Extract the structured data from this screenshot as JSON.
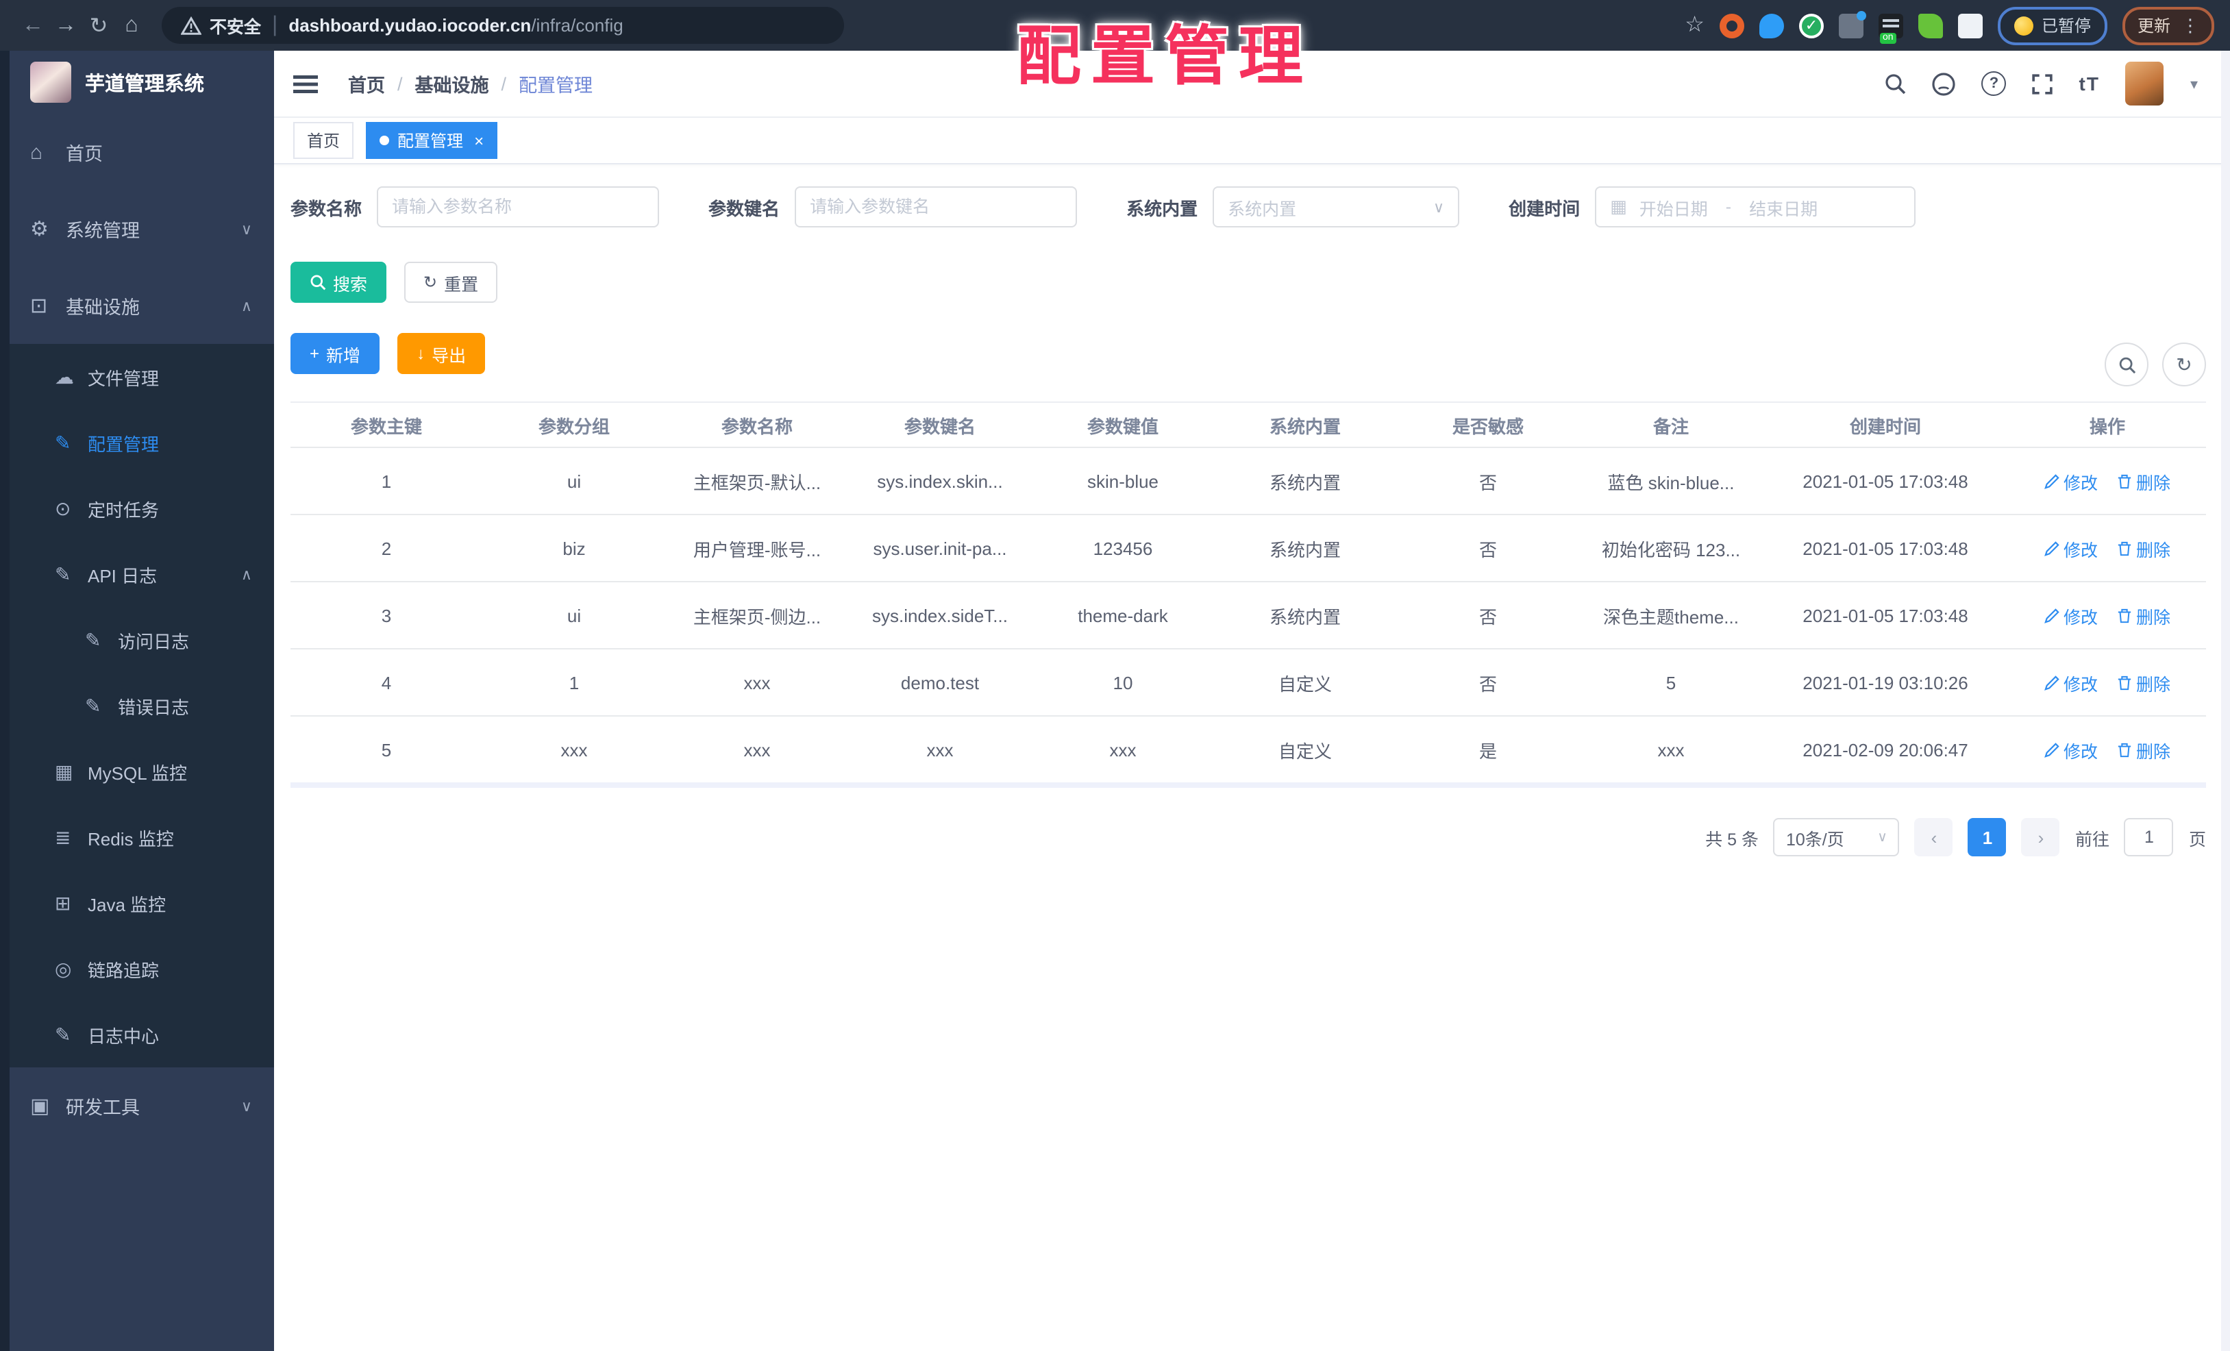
{
  "browser": {
    "security": "不安全",
    "host": "dashboard.yudao.iocoder.cn",
    "path": "/infra/config",
    "paused": "已暂停",
    "update": "更新"
  },
  "watermark": "配置管理",
  "sidebar": {
    "title": "芋道管理系统",
    "home": "首页",
    "system": "系统管理",
    "infra": "基础设施",
    "sub": [
      "文件管理",
      "配置管理",
      "定时任务",
      "API 日志",
      "访问日志",
      "错误日志",
      "MySQL 监控",
      "Redis 监控",
      "Java 监控",
      "链路追踪",
      "日志中心"
    ],
    "dev": "研发工具"
  },
  "breadcrumb": [
    "首页",
    "基础设施",
    "配置管理"
  ],
  "tabs": {
    "home": "首页",
    "active": "配置管理",
    "close": "×"
  },
  "filters": {
    "name_label": "参数名称",
    "name_ph": "请输入参数名称",
    "key_label": "参数键名",
    "key_ph": "请输入参数键名",
    "type_label": "系统内置",
    "type_ph": "系统内置",
    "date_label": "创建时间",
    "date_start": "开始日期",
    "date_sep": "-",
    "date_end": "结束日期"
  },
  "actions": {
    "search": "搜索",
    "reset": "重置",
    "add": "新增",
    "export": "导出",
    "edit": "修改",
    "delete": "删除"
  },
  "table": {
    "columns": [
      "参数主键",
      "参数分组",
      "参数名称",
      "参数键名",
      "参数键值",
      "系统内置",
      "是否敏感",
      "备注",
      "创建时间",
      "操作"
    ],
    "rows": [
      {
        "cells": [
          "1",
          "ui",
          "主框架页-默认...",
          "sys.index.skin...",
          "skin-blue",
          "系统内置",
          "否",
          "蓝色 skin-blue...",
          "2021-01-05 17:03:48"
        ]
      },
      {
        "cells": [
          "2",
          "biz",
          "用户管理-账号...",
          "sys.user.init-pa...",
          "123456",
          "系统内置",
          "否",
          "初始化密码 123...",
          "2021-01-05 17:03:48"
        ]
      },
      {
        "cells": [
          "3",
          "ui",
          "主框架页-侧边...",
          "sys.index.sideT...",
          "theme-dark",
          "系统内置",
          "否",
          "深色主题theme...",
          "2021-01-05 17:03:48"
        ]
      },
      {
        "cells": [
          "4",
          "1",
          "xxx",
          "demo.test",
          "10",
          "自定义",
          "否",
          "5",
          "2021-01-19 03:10:26"
        ]
      },
      {
        "cells": [
          "5",
          "xxx",
          "xxx",
          "xxx",
          "xxx",
          "自定义",
          "是",
          "xxx",
          "2021-02-09 20:06:47"
        ]
      }
    ]
  },
  "pagination": {
    "total": "共 5 条",
    "size": "10条/页",
    "page": "1",
    "goto": "前往",
    "unit": "页"
  },
  "icons": {
    "back": "←",
    "forward": "→",
    "reload": "↻",
    "home": "⌂",
    "star": "☆",
    "menu_dots": "⋮",
    "caret": "▾",
    "chevron_down": "∨",
    "chevron_up": "∧",
    "check": "✓",
    "refresh": "↻",
    "calendar": "▦",
    "plus": "+",
    "download": "↓",
    "prev": "‹",
    "next": "›",
    "font_size": "tT",
    "help": "?",
    "slash": "/",
    "si_home": "⌂",
    "si_gear": "⚙",
    "si_infra": "⊡",
    "si_cloud": "☁",
    "si_edit": "✎",
    "si_timer": "⊙",
    "si_log": "✎",
    "si_mysql": "▦",
    "si_redis": "≣",
    "si_java": "⊞",
    "si_eye": "◎",
    "si_tool": "▣"
  },
  "colors": {
    "accent": "#2d8cf0",
    "teal": "#1abc9c",
    "orange": "#ff9900",
    "watermark_red": "#f5315d"
  }
}
